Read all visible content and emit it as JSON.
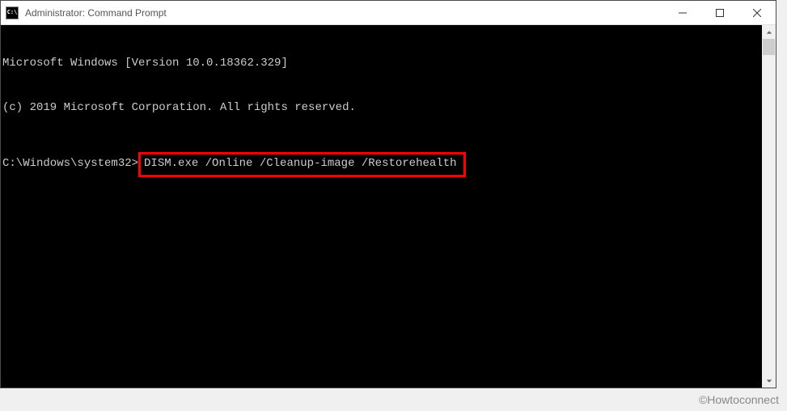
{
  "titlebar": {
    "icon_label": "C:\\",
    "title": "Administrator: Command Prompt"
  },
  "terminal": {
    "line1": "Microsoft Windows [Version 10.0.18362.329]",
    "line2": "(c) 2019 Microsoft Corporation. All rights reserved.",
    "prompt": "C:\\Windows\\system32>",
    "command": "DISM.exe /Online /Cleanup-image /Restorehealth"
  },
  "watermark": "©Howtoconnect"
}
